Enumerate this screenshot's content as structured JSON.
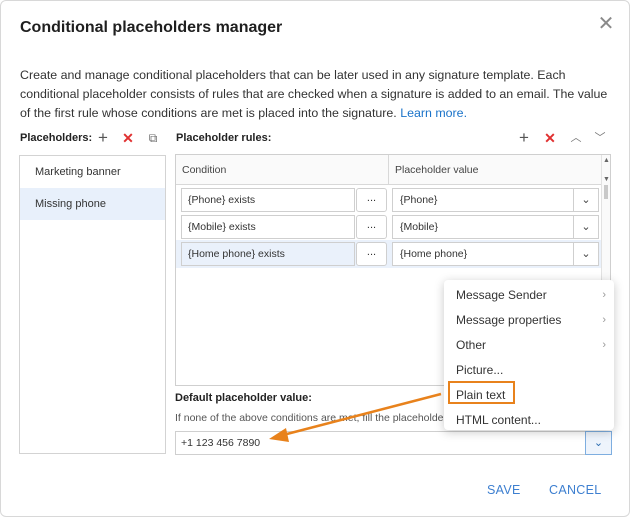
{
  "dialog": {
    "title": "Conditional placeholders manager",
    "description": "Create and manage conditional placeholders that can be later used in any signature template. Each conditional placeholder consists of rules that are checked when a signature is added to an email. The value of the first rule whose conditions are met is placed into the signature.",
    "learn_more": "Learn more."
  },
  "placeholders": {
    "label": "Placeholders:",
    "items": [
      "Marketing banner",
      "Missing phone"
    ],
    "selected": "Missing phone"
  },
  "rules": {
    "label": "Placeholder rules:",
    "columns": {
      "condition": "Condition",
      "value": "Placeholder value"
    },
    "rows": [
      {
        "condition": "{Phone} exists",
        "dots": "...",
        "value": "{Phone}"
      },
      {
        "condition": "{Mobile} exists",
        "dots": "...",
        "value": "{Mobile}"
      },
      {
        "condition": "{Home phone} exists",
        "dots": "...",
        "value": "{Home phone}"
      }
    ]
  },
  "default_value": {
    "label": "Default placeholder value:",
    "help": "If none of the above conditions are met, fill the placeholder w",
    "value": "+1 123 456 7890"
  },
  "menu": {
    "items": [
      {
        "label": "Message Sender",
        "submenu": true
      },
      {
        "label": "Message properties",
        "submenu": true
      },
      {
        "label": "Other",
        "submenu": true
      },
      {
        "label": "Picture...",
        "submenu": false
      },
      {
        "label": "Plain text",
        "submenu": false
      },
      {
        "label": "HTML content...",
        "submenu": false
      }
    ],
    "highlighted": "Plain text"
  },
  "buttons": {
    "save": "SAVE",
    "cancel": "CANCEL"
  },
  "icons": {
    "close": "close-icon",
    "add": "plus-icon",
    "delete": "x-icon",
    "copy": "copy-icon",
    "up": "chevron-up-icon",
    "down": "chevron-down-icon"
  },
  "colors": {
    "accent": "#3d7fd0",
    "link": "#1a73c9",
    "delete": "#e03030",
    "annotation": "#e8821c",
    "selection": "#e8f0fb"
  }
}
